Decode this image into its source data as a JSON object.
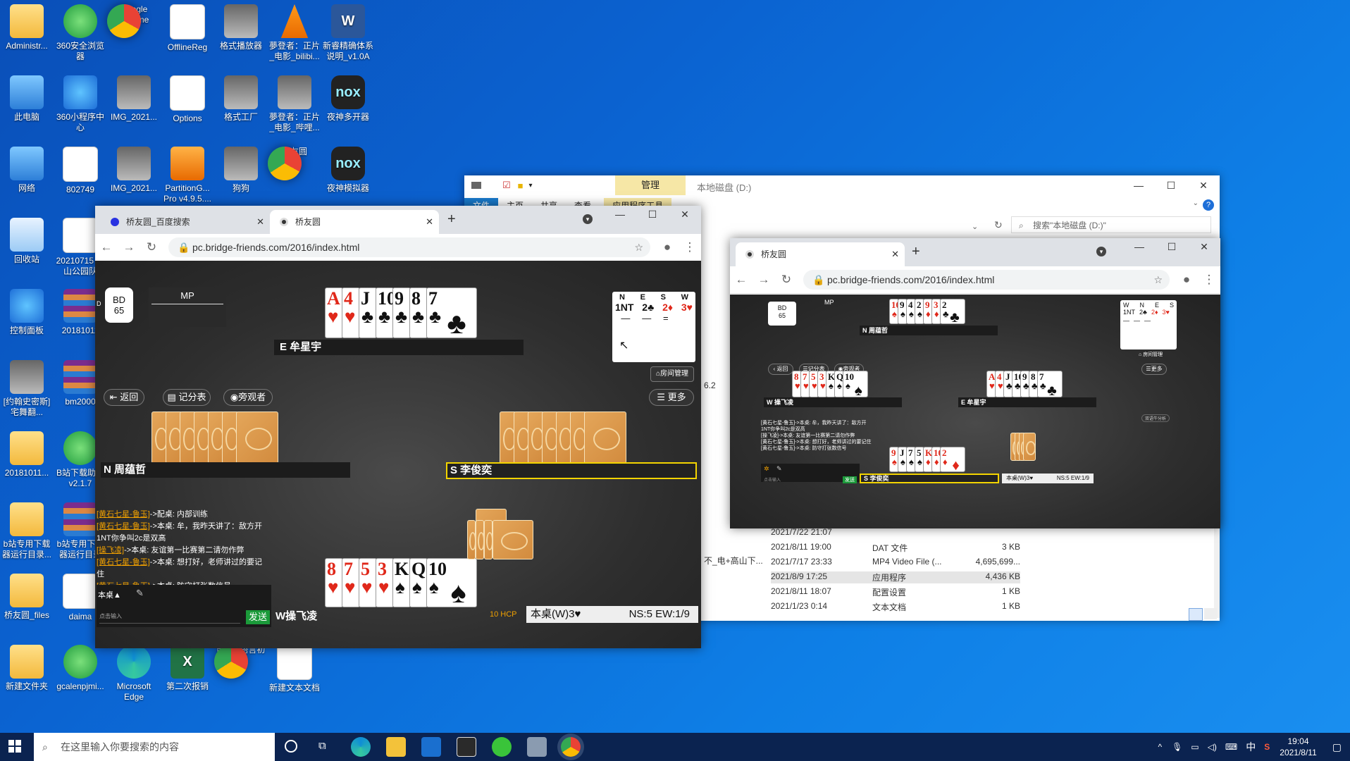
{
  "desktop": {
    "icons": [
      {
        "label": "Administr...",
        "type": "folder"
      },
      {
        "label": "360安全浏览器",
        "type": "green"
      },
      {
        "label": "Google Chrome",
        "type": "chrome"
      },
      {
        "label": "OfflineReg",
        "type": "doc"
      },
      {
        "label": "格式播放器",
        "type": "pic"
      },
      {
        "label": "夢登者：正片_电影_bilibi...",
        "type": "vlc"
      },
      {
        "label": "新睿精确体系说明_v1.0A",
        "type": "word"
      },
      {
        "label": "此电脑",
        "type": "pc"
      },
      {
        "label": "360小程序中心",
        "type": "blue"
      },
      {
        "label": "IMG_2021...",
        "type": "pic"
      },
      {
        "label": "Options",
        "type": "doc"
      },
      {
        "label": "格式工厂",
        "type": "pic"
      },
      {
        "label": "夢登者：正片_电影_哔哩...",
        "type": "pic"
      },
      {
        "label": "夜神多开器",
        "type": "nox"
      },
      {
        "label": "网络",
        "type": "pc"
      },
      {
        "label": "802749",
        "type": "doc"
      },
      {
        "label": "IMG_2021...",
        "type": "pic"
      },
      {
        "label": "PartitionG... Pro v4.9.5....",
        "type": "orange"
      },
      {
        "label": "狗狗",
        "type": "pic"
      },
      {
        "label": "桥友圆",
        "type": "chrome"
      },
      {
        "label": "夜神模拟器",
        "type": "nox"
      },
      {
        "label": "回收站",
        "type": "recycle"
      },
      {
        "label": "20210715 矿山公园队",
        "type": "doc"
      },
      {
        "label": "控制面板",
        "type": "blue"
      },
      {
        "label": "20181011",
        "type": "rar"
      },
      {
        "label": "[约翰史密斯]宅舞翻...",
        "type": "pic"
      },
      {
        "label": "bm2000",
        "type": "rar"
      },
      {
        "label": "20181011...",
        "type": "folder"
      },
      {
        "label": "B站下载助手v2.1.7",
        "type": "green"
      },
      {
        "label": "b站专用下载器运行目录...",
        "type": "folder"
      },
      {
        "label": "b站专用下载器运行目录",
        "type": "rar"
      },
      {
        "label": "桥友圆_files",
        "type": "folder"
      },
      {
        "label": "daima",
        "type": "doc"
      },
      {
        "label": "新建文件夹",
        "type": "folder"
      },
      {
        "label": "gcalenpjmi...",
        "type": "green"
      },
      {
        "label": "Microsoft Edge",
        "type": "edge"
      },
      {
        "label": "第二次报销",
        "type": "excel"
      },
      {
        "label": "明解C语言初级",
        "type": "chrome"
      },
      {
        "label": "新建文本文档",
        "type": "doc"
      }
    ]
  },
  "explorer": {
    "ribbon_tab": "管理",
    "title": "本地磁盘 (D:)",
    "menu": [
      "文件",
      "主页",
      "共享",
      "查看",
      "应用程序工具"
    ],
    "search_placeholder": "搜索\"本地磁盘 (D:)\"",
    "fragments": {
      "version": "6.2",
      "filename": "不_电+高山下..."
    },
    "rows": [
      {
        "date": "2021/7/22 21:07",
        "type": "",
        "size": ""
      },
      {
        "date": "2021/8/11 19:00",
        "type": "DAT 文件",
        "size": "3 KB"
      },
      {
        "date": "2021/7/17 23:33",
        "type": "MP4 Video File (...",
        "size": "4,695,699..."
      },
      {
        "date": "2021/8/9 17:25",
        "type": "应用程序",
        "size": "4,436 KB"
      },
      {
        "date": "2021/8/11 18:07",
        "type": "配置设置",
        "size": "1 KB"
      },
      {
        "date": "2021/1/23 0:14",
        "type": "文本文档",
        "size": "1 KB"
      }
    ]
  },
  "chrome_main": {
    "tabs": [
      {
        "label": "桥友圆_百度搜索"
      },
      {
        "label": "桥友圆"
      }
    ],
    "url": "pc.bridge-friends.com/2016/index.html",
    "board": {
      "label": "BD",
      "number": "65",
      "dealer_mark": "D",
      "scoring": "MP"
    },
    "east": {
      "name": "E 牟星宇",
      "cards": [
        [
          "A",
          "♥",
          "red"
        ],
        [
          "4",
          "♥",
          "red"
        ],
        [
          "J",
          "♣",
          "blk"
        ],
        [
          "10",
          "♣",
          "blk"
        ],
        [
          "9",
          "♣",
          "blk"
        ],
        [
          "8",
          "♣",
          "blk"
        ],
        [
          "7",
          "♣",
          "blk"
        ]
      ]
    },
    "north": {
      "name": "N 周蕴哲"
    },
    "south": {
      "name": "S 李俊奕"
    },
    "west": {
      "name": "W操飞凌",
      "cards": [
        [
          "8",
          "♥",
          "red"
        ],
        [
          "7",
          "♥",
          "red"
        ],
        [
          "5",
          "♥",
          "red"
        ],
        [
          "3",
          "♥",
          "red"
        ],
        [
          "K",
          "♠",
          "blk"
        ],
        [
          "Q",
          "♠",
          "blk"
        ],
        [
          "10",
          "♠",
          "blk"
        ]
      ]
    },
    "bidding": {
      "headers": [
        "N",
        "E",
        "S",
        "W"
      ],
      "bids": [
        [
          "1NT",
          "blk"
        ],
        [
          "2♣",
          "blk"
        ],
        [
          "2♦",
          "red"
        ],
        [
          "3♥",
          "red"
        ]
      ],
      "row2": [
        "—",
        "—",
        "="
      ]
    },
    "buttons": {
      "back": "返回",
      "score": "记分表",
      "spectators": "旁观者",
      "more": "更多",
      "room": "房间管理",
      "send": "发送"
    },
    "chat": [
      {
        "who": "[黄石七星-鲁玉]",
        "text": "->配桌: 内部训练"
      },
      {
        "who": "[黄石七星-鲁玉]",
        "text": "->本桌: 牟，我昨天讲了：敌方开1NT你争叫2c是双高"
      },
      {
        "who": "[操飞凌]",
        "text": "->本桌: 友谊第一比赛第二请勿作弊"
      },
      {
        "who": "[黄石七星-鲁玉]",
        "text": "->本桌: 想打好，老师讲过的要记住"
      },
      {
        "who": "[黄石七星-鲁玉]",
        "text": "->本桌: 防守打张数信号"
      }
    ],
    "chat_scope": "本桌",
    "chat_placeholder": "点击输入",
    "hcp": "10 HCP",
    "contract": "本桌(W)3♥",
    "score_status": "NS:5 EW:1/9"
  },
  "chrome_second": {
    "tab": "桥友圆",
    "url": "pc.bridge-friends.com/2016/index.html",
    "board": {
      "label": "BD",
      "number": "65",
      "scoring": "MP"
    },
    "north": {
      "name": "N 周蕴哲",
      "cards": [
        [
          "10",
          "♠",
          "red"
        ],
        [
          "9",
          "♠",
          "blk"
        ],
        [
          "4",
          "♠",
          "blk"
        ],
        [
          "2",
          "♠",
          "blk"
        ],
        [
          "9",
          "♦",
          "red"
        ],
        [
          "3",
          "♦",
          "red"
        ],
        [
          "2",
          "♣",
          "blk"
        ]
      ]
    },
    "west": {
      "name": "W 操飞凌",
      "cards": [
        [
          "8",
          "♥",
          "red"
        ],
        [
          "7",
          "♥",
          "red"
        ],
        [
          "5",
          "♥",
          "red"
        ],
        [
          "3",
          "♥",
          "red"
        ],
        [
          "K",
          "♠",
          "blk"
        ],
        [
          "Q",
          "♠",
          "blk"
        ],
        [
          "10",
          "♠",
          "blk"
        ]
      ]
    },
    "east": {
      "name": "E 牟星宇",
      "cards": [
        [
          "A",
          "♥",
          "red"
        ],
        [
          "4",
          "♥",
          "red"
        ],
        [
          "J",
          "♣",
          "blk"
        ],
        [
          "10",
          "♣",
          "blk"
        ],
        [
          "9",
          "♣",
          "blk"
        ],
        [
          "8",
          "♣",
          "blk"
        ],
        [
          "7",
          "♣",
          "blk"
        ]
      ]
    },
    "south": {
      "name": "S 李俊奕",
      "cards": [
        [
          "9",
          "♠",
          "red"
        ],
        [
          "J",
          "♠",
          "blk"
        ],
        [
          "7",
          "♠",
          "blk"
        ],
        [
          "5",
          "♠",
          "blk"
        ],
        [
          "K",
          "♦",
          "red"
        ],
        [
          "10",
          "♦",
          "red"
        ],
        [
          "2",
          "♦",
          "red"
        ]
      ]
    },
    "bidding": {
      "headers": [
        "W",
        "N",
        "E",
        "S"
      ],
      "bids": [
        "1NT",
        "2♣",
        "2♦",
        "3♥",
        "—",
        "—",
        "—"
      ]
    },
    "buttons": {
      "back": "返回",
      "score": "记分表",
      "spectators": "旁观者",
      "more": "更多",
      "room": "房间管理",
      "analysis": "双语牛分析",
      "send": "发送"
    },
    "chat": [
      "[黄石七星-鲁玉]->本桌: 牟，我昨天讲了：敌方开1NT你争叫2c是双高",
      "[操飞凌]->本桌: 友谊第一比赛第二请勿作弊",
      "[黄石七星-鲁玉]->本桌: 想打好，老师讲过的要记住",
      "[黄石七星-鲁玉]->本桌: 防守打张数信号"
    ],
    "chat_placeholder": "点击输入",
    "contract": "本桌(W)3♥",
    "score_status": "NS:5 EW:1/9"
  },
  "taskbar": {
    "search_placeholder": "在这里输入你要搜索的内容",
    "ime": "中",
    "time": "19:04",
    "date": "2021/8/11"
  }
}
